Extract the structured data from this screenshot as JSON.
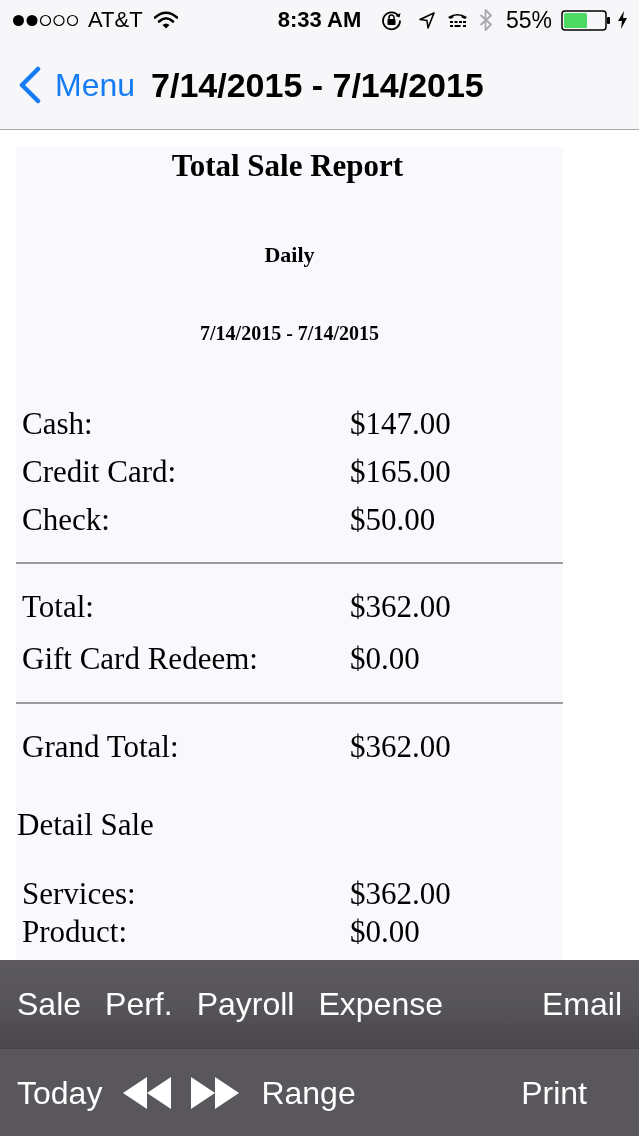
{
  "status_bar": {
    "carrier": "AT&T",
    "time": "8:33 AM",
    "battery": "55%"
  },
  "nav_bar": {
    "back_label": "Menu",
    "title": "7/14/2015 - 7/14/2015"
  },
  "report": {
    "title": "Total Sale Report",
    "period": "Daily",
    "date_range": "7/14/2015 - 7/14/2015",
    "payments": [
      {
        "label": "Cash:",
        "value": "$147.00"
      },
      {
        "label": "Credit Card:",
        "value": "$165.00"
      },
      {
        "label": "Check:",
        "value": "$50.00"
      }
    ],
    "totals": [
      {
        "label": "Total:",
        "value": "$362.00"
      },
      {
        "label": "Gift Card Redeem:",
        "value": "$0.00"
      }
    ],
    "grand_total": {
      "label": "Grand Total:",
      "value": "$362.00"
    },
    "detail_heading": "Detail Sale",
    "details": [
      {
        "label": "Services:",
        "value": "$362.00"
      },
      {
        "label": "Product:",
        "value": "$0.00"
      }
    ]
  },
  "top_toolbar": {
    "report_types": [
      "Sale",
      "Perf.",
      "Payroll",
      "Expense"
    ],
    "email": "Email"
  },
  "bottom_toolbar": {
    "today": "Today",
    "range": "Range",
    "print": "Print"
  }
}
